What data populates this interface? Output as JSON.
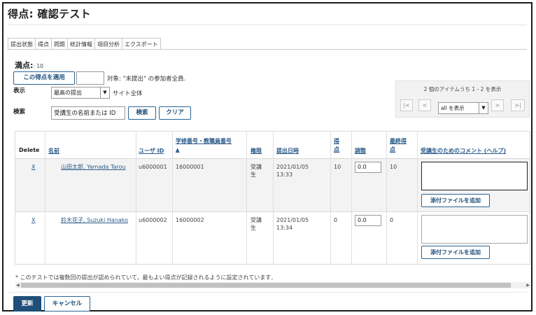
{
  "page": {
    "title": "得点: 確認テスト"
  },
  "tabs": [
    {
      "label": "提出状態"
    },
    {
      "label": "得点"
    },
    {
      "label": "問題"
    },
    {
      "label": "統計情報"
    },
    {
      "label": "項目分析"
    },
    {
      "label": "エクスポート"
    }
  ],
  "max_points": {
    "label": "満点:",
    "value": ": 10"
  },
  "apply_score": {
    "button_label": "この得点を適用",
    "input_value": "",
    "target_text": "対象: \"未提出\" の参加者全員."
  },
  "view": {
    "label": "表示",
    "select_value": "最高の提出",
    "scope_text": "サイト全体"
  },
  "search": {
    "label": "検索",
    "input_value": "受講生の名前または ID",
    "search_button": "検索",
    "clear_button": "クリア"
  },
  "pager": {
    "info": "2 個のアイテムうち 1 - 2 を表示",
    "first": "|<",
    "prev": "<",
    "page_size": "all を表示",
    "next": ">",
    "last": ">|"
  },
  "table": {
    "headers": {
      "delete": "Delete",
      "name": "名前",
      "user_id": "ユーザ ID",
      "student_no": "学修番号・教職員番号",
      "student_no_sort": "▲",
      "role": "権限",
      "submitted": "提出日時",
      "score": "得点",
      "adjust": "調整",
      "final": "最終得点",
      "comment": "受講生のためのコメント",
      "help": "(ヘルプ)"
    },
    "rows": [
      {
        "delete": "X",
        "name": "山田太郎, Yamada Tarou",
        "user_id": "u6000001",
        "student_no": "16000001",
        "role": "受講生",
        "submitted": "2021/01/05 13:33",
        "score": "10",
        "adjust": "0.0",
        "final": "10",
        "comment": "",
        "attach_label": "添付ファイルを追加"
      },
      {
        "delete": "X",
        "name": "鈴木花子, Suzuki Hanako",
        "user_id": "u6000002",
        "student_no": "16000002",
        "role": "受講生",
        "submitted": "2021/01/05 13:34",
        "score": "0",
        "adjust": "0.0",
        "final": "0",
        "comment": "",
        "attach_label": "添付ファイルを追加"
      }
    ]
  },
  "footnote": "* このテストでは複数回の提出が認められていて，最もよい得点が記録されるように設定されています．",
  "actions": {
    "update": "更新",
    "cancel": "キャンセル"
  },
  "colors": {
    "primary": "#1f4e79",
    "link": "#2a5b8a",
    "row_highlight": "#f3f3f3"
  },
  "icons": [
    "dropdown-arrow-icon",
    "sort-ascending-icon",
    "scroll-left-icon",
    "scroll-right-icon"
  ]
}
